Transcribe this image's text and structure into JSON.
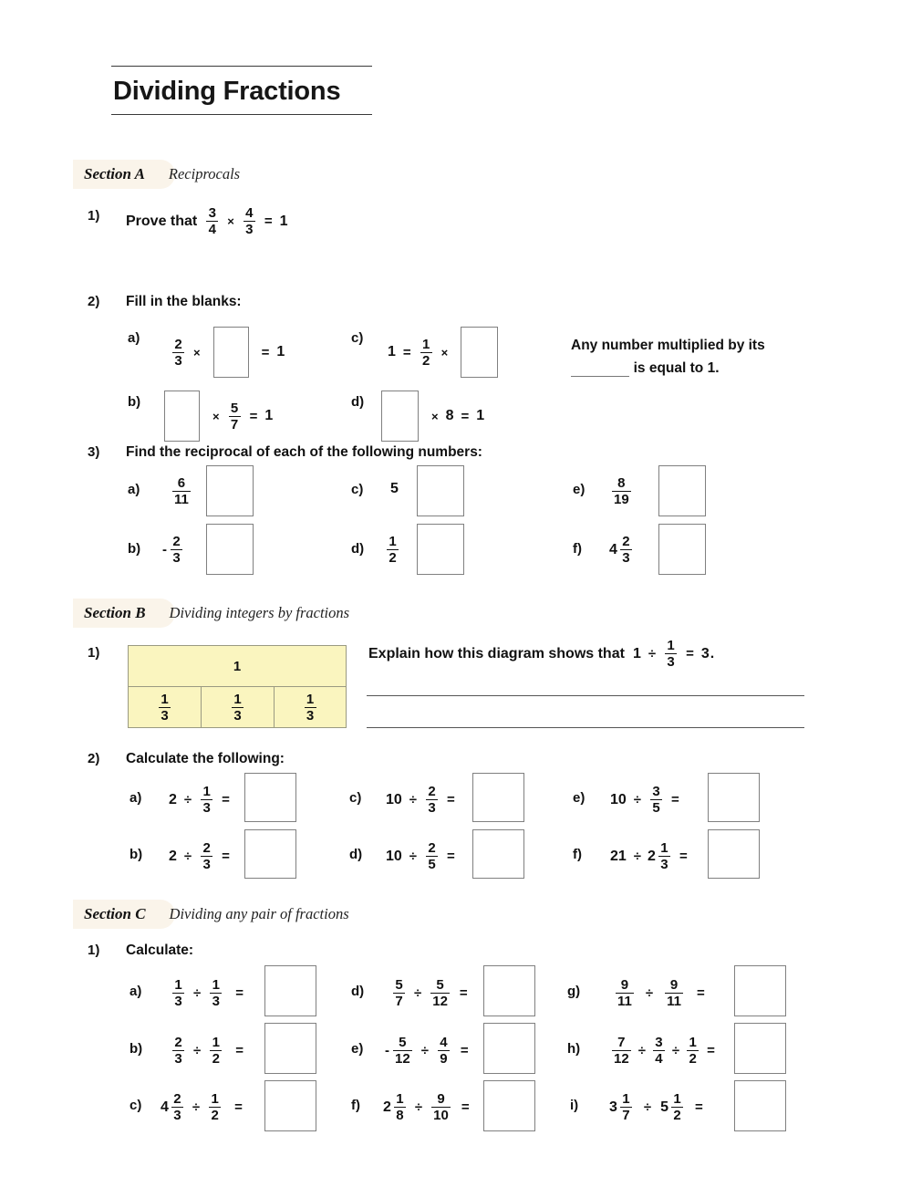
{
  "worksheet": {
    "title": "Dividing Fractions"
  },
  "sections": [
    {
      "id": "A",
      "name": "Section A",
      "description": "Reciprocals",
      "questions": [
        {
          "number": "1)",
          "text": "Prove that",
          "expression": "3/4 × 4/3 = 1"
        },
        {
          "number": "2)",
          "text": "Fill in the blanks:",
          "parts": [
            {
              "label": "a)",
              "expr": "2/3 × □ = 1"
            },
            {
              "label": "b)",
              "expr": "□ × 5/7 = 1"
            },
            {
              "label": "c)",
              "expr": "1 = 1/2 × □"
            },
            {
              "label": "d)",
              "expr": "□ × 8 = 1"
            }
          ],
          "note_before": "Any number multiplied by its",
          "note_blank": "",
          "note_after": "is equal to 1."
        },
        {
          "number": "3)",
          "text": "Find the reciprocal of each of the following numbers:",
          "parts": [
            {
              "label": "a)",
              "value": "6/11"
            },
            {
              "label": "b)",
              "value": "-2/3"
            },
            {
              "label": "c)",
              "value": "5"
            },
            {
              "label": "d)",
              "value": "1/2"
            },
            {
              "label": "e)",
              "value": "8/19"
            },
            {
              "label": "f)",
              "value": "4 2/3"
            }
          ]
        }
      ]
    },
    {
      "id": "B",
      "name": "Section B",
      "description": "Dividing integers by fractions",
      "questions": [
        {
          "number": "1)",
          "prompt_before": "Explain how this diagram shows that",
          "prompt_expr": "1 ÷ 1/3 = 3.",
          "diagram": {
            "whole_label": "1",
            "parts": [
              "1/3",
              "1/3",
              "1/3"
            ]
          }
        },
        {
          "number": "2)",
          "text": "Calculate the following:",
          "parts": [
            {
              "label": "a)",
              "expr": "2 ÷ 1/3 ="
            },
            {
              "label": "b)",
              "expr": "2 ÷ 2/3 ="
            },
            {
              "label": "c)",
              "expr": "10 ÷ 2/3 ="
            },
            {
              "label": "d)",
              "expr": "10 ÷ 2/5 ="
            },
            {
              "label": "e)",
              "expr": "10 ÷ 3/5 ="
            },
            {
              "label": "f)",
              "expr": "21 ÷ 2 1/3 ="
            }
          ]
        }
      ]
    },
    {
      "id": "C",
      "name": "Section C",
      "description": "Dividing any pair of fractions",
      "questions": [
        {
          "number": "1)",
          "text": "Calculate:",
          "parts": [
            {
              "label": "a)",
              "expr": "1/3 ÷ 1/3 ="
            },
            {
              "label": "b)",
              "expr": "2/3 ÷ 1/2 ="
            },
            {
              "label": "c)",
              "expr": "4 2/3 ÷ 1/2 ="
            },
            {
              "label": "d)",
              "expr": "5/7 ÷ 5/12 ="
            },
            {
              "label": "e)",
              "expr": "-5/12 ÷ 4/9 ="
            },
            {
              "label": "f)",
              "expr": "2 1/8 ÷ 9/10 ="
            },
            {
              "label": "g)",
              "expr": "9/11 ÷ 9/11 ="
            },
            {
              "label": "h)",
              "expr": "7/12 ÷ 3/4 ÷ 1/2 ="
            },
            {
              "label": "i)",
              "expr": "3 1/7 ÷ 5 1/2 ="
            }
          ]
        }
      ]
    }
  ],
  "labels": {
    "a": "a)",
    "b": "b)",
    "c": "c)",
    "d": "d)",
    "e": "e)",
    "f": "f)",
    "g": "g)",
    "h": "h)",
    "i": "i)"
  },
  "numbers": {
    "q1": "1)",
    "q2": "2)",
    "q3": "3)",
    "n1": "1",
    "n2": "2",
    "n3": "3",
    "n4": "4",
    "n5": "5",
    "n6": "6",
    "n7": "7",
    "n8": "8",
    "n9": "9",
    "n10": "10",
    "n11": "11",
    "n12": "12",
    "n19": "19",
    "n21": "21"
  },
  "ops": {
    "times": "×",
    "divide": "÷",
    "equals": "=",
    "minus": "-",
    "period": "."
  },
  "colors": {
    "diagram_fill": "#faf5bf",
    "diagram_border": "#9a9a82",
    "badge_bg": "#faf4ea",
    "box_border": "#808080",
    "text": "#1a1a1a"
  }
}
